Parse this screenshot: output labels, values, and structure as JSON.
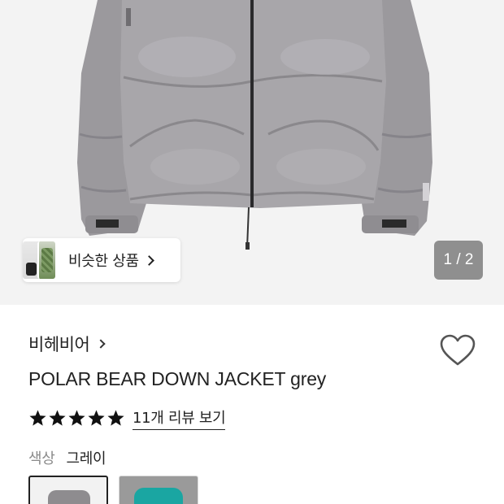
{
  "hero": {
    "image_icon": "grey-down-jacket-photo",
    "similar": {
      "label": "비슷한 상품",
      "chevron_icon": "chevron-right-icon"
    },
    "counter": "1 / 2"
  },
  "product": {
    "brand": "비헤비어",
    "brand_chevron_icon": "chevron-right-icon",
    "wishlist_icon": "heart-outline-icon",
    "title": "POLAR BEAR DOWN JACKET grey",
    "rating": {
      "stars": 5,
      "max_stars": 5,
      "star_color": "#111111",
      "review_link": "11개 리뷰 보기"
    },
    "option": {
      "label": "색상",
      "value": "그레이"
    },
    "swatches": [
      {
        "name": "grey",
        "selected": true,
        "color": "#8e8c8f"
      },
      {
        "name": "teal",
        "selected": false,
        "color": "#1aa6a2"
      }
    ]
  }
}
